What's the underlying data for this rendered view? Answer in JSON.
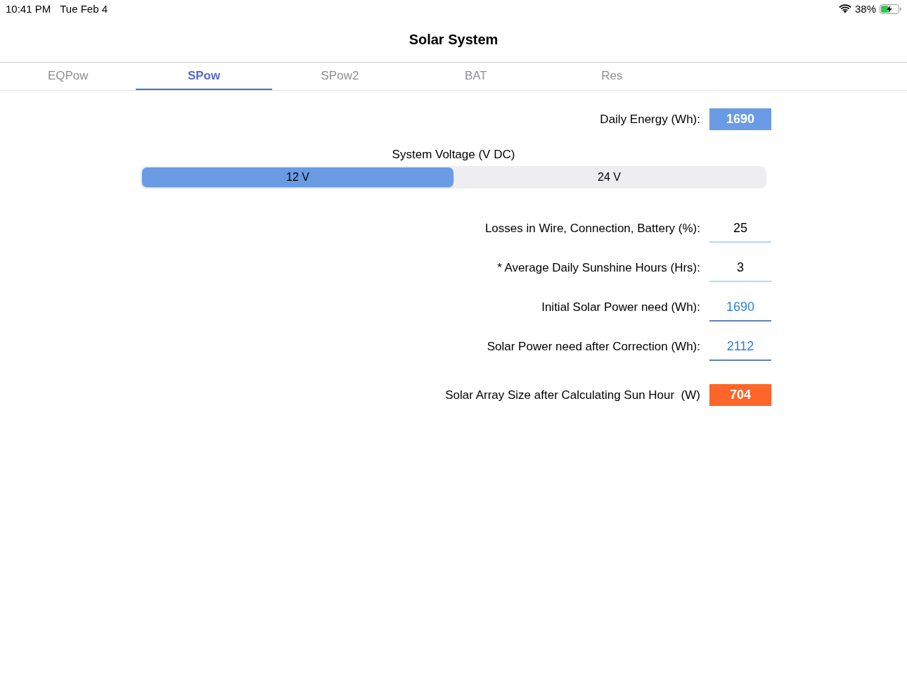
{
  "status_bar": {
    "time": "10:41 PM",
    "date": "Tue Feb 4",
    "battery_percent": "38%"
  },
  "nav_bar": {
    "title": "Solar System"
  },
  "tabs": [
    {
      "label": "EQPow",
      "selected": false
    },
    {
      "label": "SPow",
      "selected": true
    },
    {
      "label": "SPow2",
      "selected": false
    },
    {
      "label": "BAT",
      "selected": false
    },
    {
      "label": "Res",
      "selected": false
    }
  ],
  "daily_energy": {
    "label": "Daily Energy (Wh):",
    "value": "1690"
  },
  "system_voltage": {
    "label": "System Voltage (V DC)",
    "options": [
      {
        "label": "12 V",
        "selected": true
      },
      {
        "label": "24 V",
        "selected": false
      }
    ]
  },
  "fields": [
    {
      "kind": "input",
      "label": "Losses in Wire, Connection, Battery (%):",
      "value": "25"
    },
    {
      "kind": "input",
      "label": "* Average Daily Sunshine Hours (Hrs):",
      "value": "3"
    },
    {
      "kind": "output",
      "label": "Initial Solar Power need (Wh):",
      "value": "1690"
    },
    {
      "kind": "output",
      "label": "Solar Power need after Correction (Wh):",
      "value": "2112"
    }
  ],
  "result": {
    "label": "Solar Array Size after Calculating Sun Hour  (W)",
    "value": "704"
  }
}
